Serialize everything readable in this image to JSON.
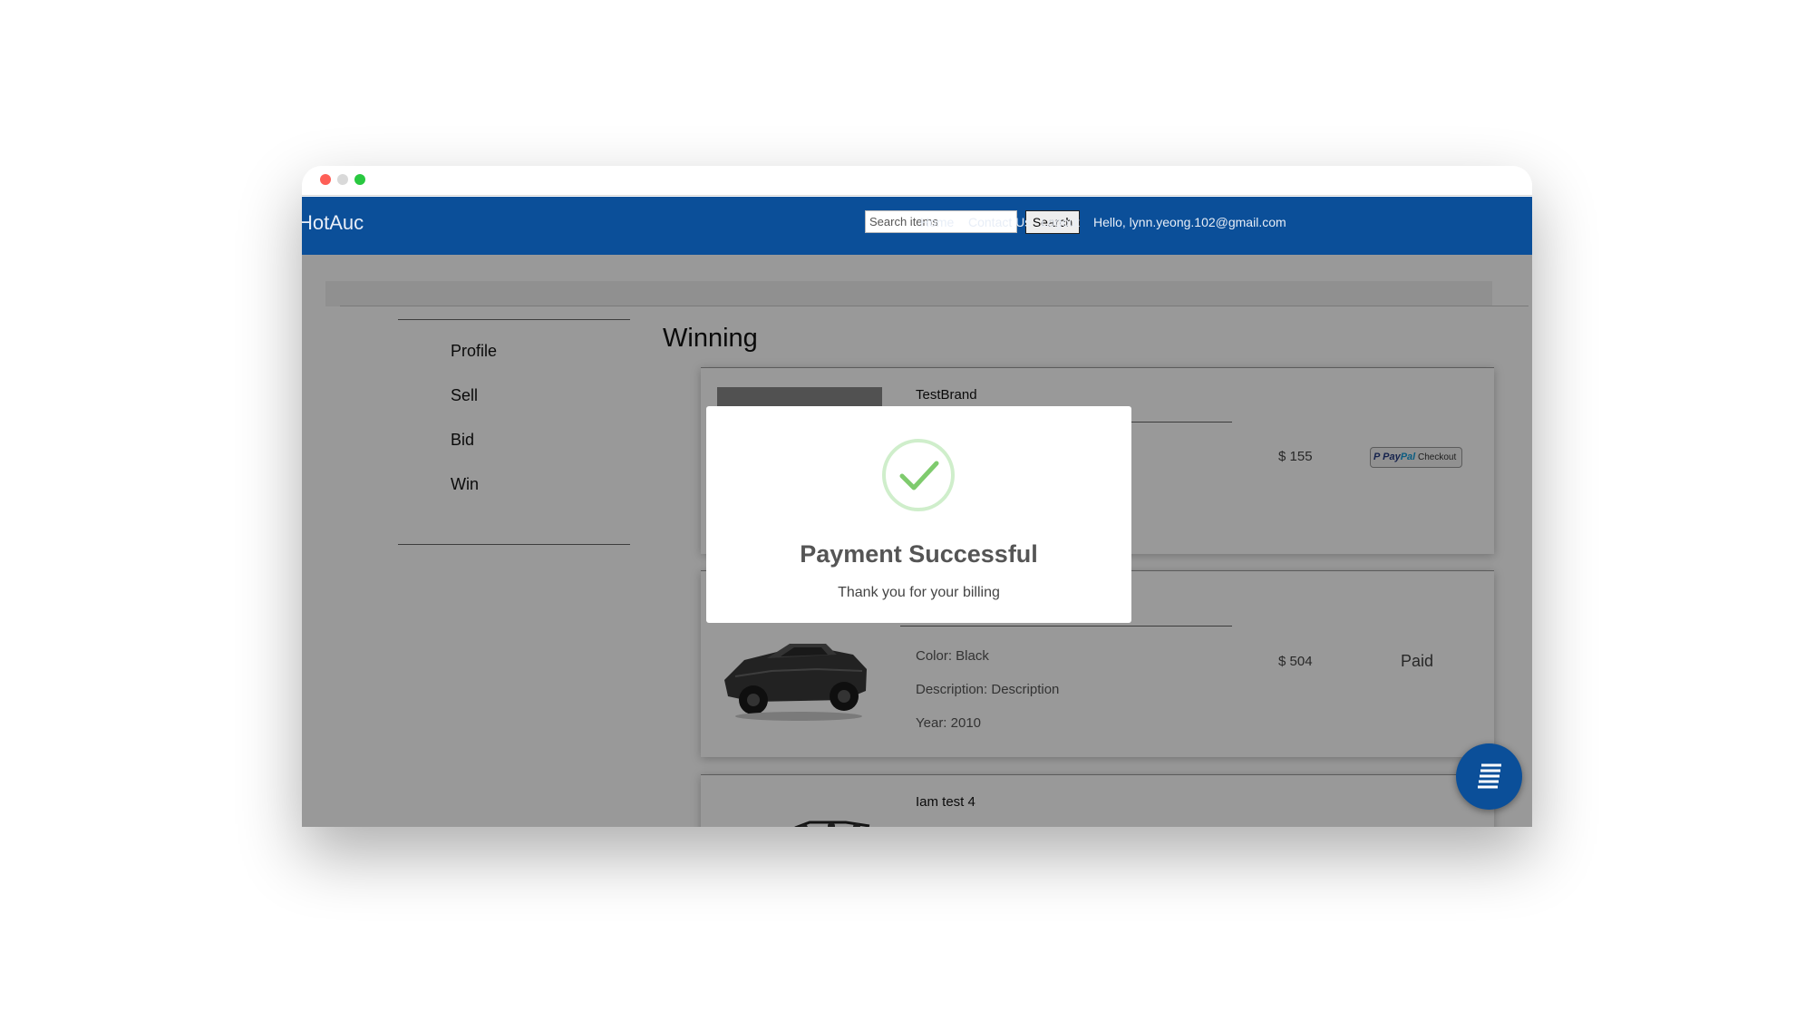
{
  "window": {
    "controls": [
      "close",
      "minimize",
      "zoom"
    ]
  },
  "navbar": {
    "brand": "HotAuc",
    "search_placeholder": "Search items",
    "search_label": "Search",
    "links": {
      "home": "Home",
      "contact": "Contact Us",
      "logout": "Logout"
    },
    "greeting": "Hello, lynn.yeong.102@gmail.com"
  },
  "sidebar": {
    "items": [
      {
        "label": "Profile"
      },
      {
        "label": "Sell"
      },
      {
        "label": "Bid"
      },
      {
        "label": "Win"
      }
    ]
  },
  "main": {
    "title": "Winning",
    "items": [
      {
        "name": "TestBrand",
        "price": "$ 155",
        "action": "PayPal Checkout"
      },
      {
        "color": "Color: Black",
        "description": "Description: Description",
        "year": "Year: 2010",
        "price": "$ 504",
        "status": "Paid"
      },
      {
        "name": "Iam test 4"
      }
    ]
  },
  "modal": {
    "title": "Payment Successful",
    "message": "Thank you for your billing",
    "icon": "check-circle-icon"
  },
  "fab": {
    "icon": "hamburger-icon"
  },
  "colors": {
    "navbar": "#0b4f99",
    "success": "#5fbd5f",
    "fab": "#0b4f99"
  }
}
